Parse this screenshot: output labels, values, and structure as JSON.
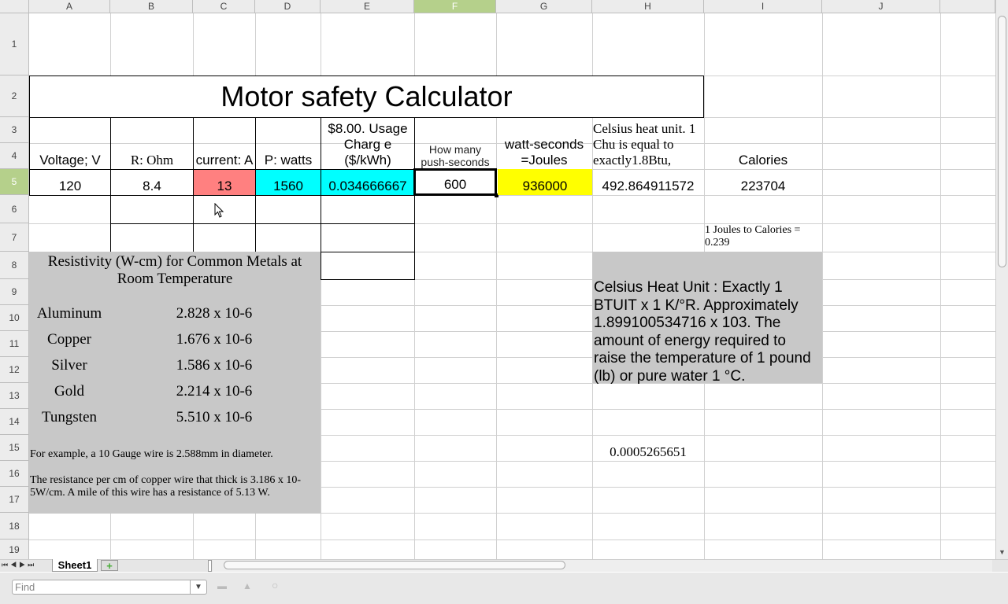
{
  "columns": [
    "A",
    "B",
    "C",
    "D",
    "E",
    "F",
    "G",
    "H",
    "I",
    "J"
  ],
  "rows": [
    "1",
    "2",
    "3",
    "4",
    "5",
    "6",
    "7",
    "8",
    "9",
    "10",
    "11",
    "12",
    "13",
    "14",
    "15",
    "16",
    "17",
    "18",
    "19"
  ],
  "title": "Motor safety Calculator",
  "headers": {
    "voltage": "Voltage; V",
    "resistance": "R: Ohm",
    "current": "current: A",
    "power": "P: watts",
    "charge": "$8.00. Usage Charg e ($/kWh)",
    "push": "How many push-seconds",
    "joules": "watt-seconds =Joules",
    "chu": "Celsius heat unit. 1 Chu is equal to exactly1.8Btu,",
    "calories": "Calories"
  },
  "values": {
    "voltage": "120",
    "resistance": "8.4",
    "current": "13",
    "power": "1560",
    "charge": "0.034666667",
    "push": "600",
    "joules": "936000",
    "chu": "492.864911572",
    "calories": "223704"
  },
  "joules_note": "1 Joules to Calories = 0.239",
  "resistivity": {
    "title": "Resistivity (W-cm) for Common Metals at Room Temperature",
    "metals": [
      {
        "name": "Aluminum",
        "value": "2.828 x 10-6"
      },
      {
        "name": "Copper",
        "value": "1.676 x 10-6"
      },
      {
        "name": "Silver",
        "value": "1.586 x 10-6"
      },
      {
        "name": "Gold",
        "value": "2.214 x 10-6"
      },
      {
        "name": "Tungsten",
        "value": "5.510 x 10-6"
      }
    ],
    "example": "For example, a 10 Gauge wire is 2.588mm in diameter.",
    "note": "The resistance per cm of copper wire that thick is 3.186 x 10-5W/cm. A mile of this wire has a resistance of 5.13 W."
  },
  "chu_note": "Celsius Heat Unit : Exactly 1 BTUIT x 1 K/°R. Approximately 1.899100534716 x 103. The amount of energy required to raise the temperature of 1 pound (lb) or pure water 1 °C.",
  "h15": "0.0005265651",
  "sheet_tab": "Sheet1",
  "find_placeholder": "Find",
  "colors": {
    "current": "#ff8080",
    "cyan": "#00ffff",
    "yellow": "#ffff00",
    "gray": "#c8c8c8"
  }
}
